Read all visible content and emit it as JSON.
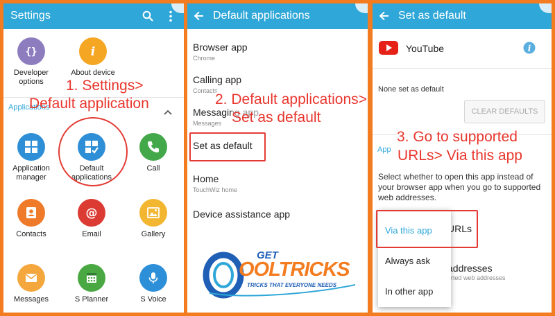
{
  "panel1": {
    "title": "Settings",
    "top_apps": [
      {
        "label": "Developer\noptions",
        "icon": "braces-icon",
        "color": "#8d7dbf"
      },
      {
        "label": "About device",
        "icon": "info-icon",
        "color": "#f5a623"
      }
    ],
    "section_label": "Applications",
    "apps": [
      {
        "label": "Application\nmanager",
        "icon": "grid-icon",
        "color": "#2e8fd6"
      },
      {
        "label": "Default\napplications",
        "icon": "grid-check-icon",
        "color": "#2e8fd6"
      },
      {
        "label": "Call",
        "icon": "phone-icon",
        "color": "#43a84a"
      },
      {
        "label": "Contacts",
        "icon": "contact-icon",
        "color": "#ee7a2a"
      },
      {
        "label": "Email",
        "icon": "at-icon",
        "color": "#dc3b33"
      },
      {
        "label": "Gallery",
        "icon": "gallery-icon",
        "color": "#f2b630"
      },
      {
        "label": "Messages",
        "icon": "envelope-icon",
        "color": "#f3a73c"
      },
      {
        "label": "S Planner",
        "icon": "calendar-icon",
        "color": "#49a842"
      },
      {
        "label": "S Voice",
        "icon": "mic-icon",
        "color": "#2d8fd8"
      }
    ],
    "annotation_line1": "1. Settings>",
    "annotation_line2": "Default application"
  },
  "panel2": {
    "title": "Default applications",
    "items": [
      {
        "title": "Browser app",
        "sub": "Chrome"
      },
      {
        "title": "Calling app",
        "sub": "Contacts"
      },
      {
        "title": "Messaging app",
        "sub": "Messages"
      },
      {
        "title": "Set as default",
        "sub": ""
      },
      {
        "title": "Home",
        "sub": "TouchWiz home"
      },
      {
        "title": "Device assistance app",
        "sub": ""
      }
    ],
    "annotation_line1": "2. Default applications>",
    "annotation_line2": "Set as default"
  },
  "panel3": {
    "title": "Set as default",
    "app_name": "YouTube",
    "none_text": "None set as default",
    "clear_button": "CLEAR DEFAULTS",
    "section_label": "App",
    "description": "Select whether to open this app instead of your browser app when you go to supported web addresses.",
    "behind_urls": "URLs",
    "behind_addr_title": "addresses",
    "behind_addr_sub": "orted web addresses",
    "options": [
      "Via this app",
      "Always ask",
      "In other app"
    ],
    "annotation_line1": "3. Go to supported",
    "annotation_line2": "URLs> Via this app"
  },
  "watermark": {
    "get": "GET",
    "brand": "OOLTRICKS",
    "tagline": "TRICKS THAT EVERYONE NEEDS"
  },
  "colors": {
    "accent": "#2fa7d8",
    "annotation": "#e8352c",
    "frame": "#f47c20"
  }
}
